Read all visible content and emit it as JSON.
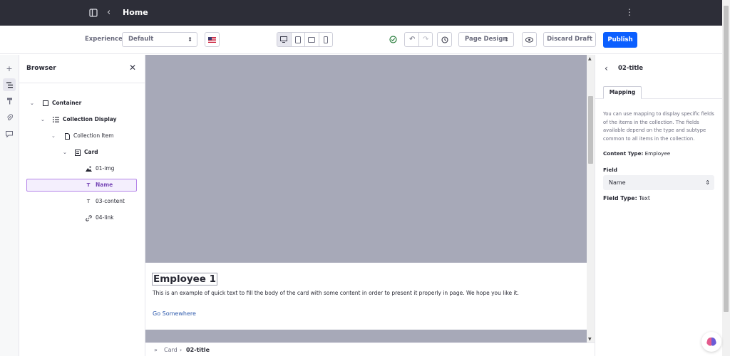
{
  "topbar": {
    "title": "Home"
  },
  "toolbar": {
    "experience_label": "Experience",
    "experience_value": "Default",
    "mode_value": "Page Design",
    "discard_label": "Discard Draft",
    "publish_label": "Publish"
  },
  "browser": {
    "title": "Browser",
    "items": [
      {
        "label": "Container"
      },
      {
        "label": "Collection Display"
      },
      {
        "label": "Collection Item"
      },
      {
        "label": "Card"
      },
      {
        "label": "01-img"
      },
      {
        "label": "Name"
      },
      {
        "label": "03-content"
      },
      {
        "label": "04-link"
      }
    ]
  },
  "canvas": {
    "card_title": "Employee 1",
    "card_text": "This is an example of quick text to fill the body of the card with some content in order to present it properly in page. We hope you like it.",
    "card_link": "Go Somewhere"
  },
  "breadcrumb": {
    "parent": "Card",
    "current": "02-title"
  },
  "config": {
    "title": "02-title",
    "tab": "Mapping",
    "description": "You can use mapping to display specific fields of the items in the collection. The fields available depend on the type and subtype common to all items in the collection.",
    "content_type_label": "Content Type:",
    "content_type_value": "Employee",
    "field_label": "Field",
    "field_value": "Name",
    "field_type_label": "Field Type:",
    "field_type_value": "Text"
  },
  "colors": {
    "accent": "#0b5fff",
    "topbar": "#2d2e38",
    "image_placeholder": "#a7a9b8",
    "selection": "#b484e8"
  }
}
